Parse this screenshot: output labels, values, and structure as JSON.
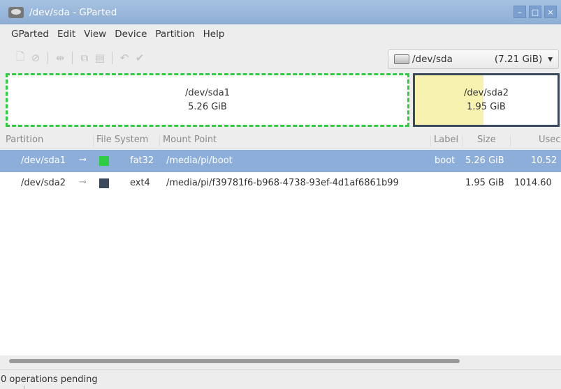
{
  "window": {
    "title": "/dev/sda - GParted"
  },
  "menu": [
    "GParted",
    "Edit",
    "View",
    "Device",
    "Partition",
    "Help"
  ],
  "toolbar": {
    "icons": [
      "new-icon",
      "delete-icon",
      "resize-icon",
      "copy-icon",
      "paste-icon",
      "undo-icon",
      "apply-icon"
    ]
  },
  "device": {
    "name": "/dev/sda",
    "size": "(7.21 GiB)"
  },
  "diskmap": {
    "partitions": [
      {
        "name": "/dev/sda1",
        "size": "5.26 GiB",
        "fs_color": "#2ecc40"
      },
      {
        "name": "/dev/sda2",
        "size": "1.95 GiB",
        "usage_fraction": 0.48
      }
    ]
  },
  "table": {
    "columns": {
      "partition": "Partition",
      "filesystem": "File System",
      "mountpoint": "Mount Point",
      "label": "Label",
      "size": "Size",
      "used": "Usec"
    },
    "rows": [
      {
        "partition": "/dev/sda1",
        "fs": "fat32",
        "fs_color": "#2ecc40",
        "mount": "/media/pi/boot",
        "label": "boot",
        "size": "5.26 GiB",
        "used": "10.52"
      },
      {
        "partition": "/dev/sda2",
        "fs": "ext4",
        "fs_color": "#3a4a5c",
        "mount": "/media/pi/f39781f6-b968-4738-93ef-4d1af6861b99",
        "label": "",
        "size": "1.95 GiB",
        "used": "1014.60"
      }
    ]
  },
  "status": {
    "text": "0 operations pending"
  },
  "colors": {
    "titlebar": "#8eaed4",
    "selection": "#8daed9"
  }
}
